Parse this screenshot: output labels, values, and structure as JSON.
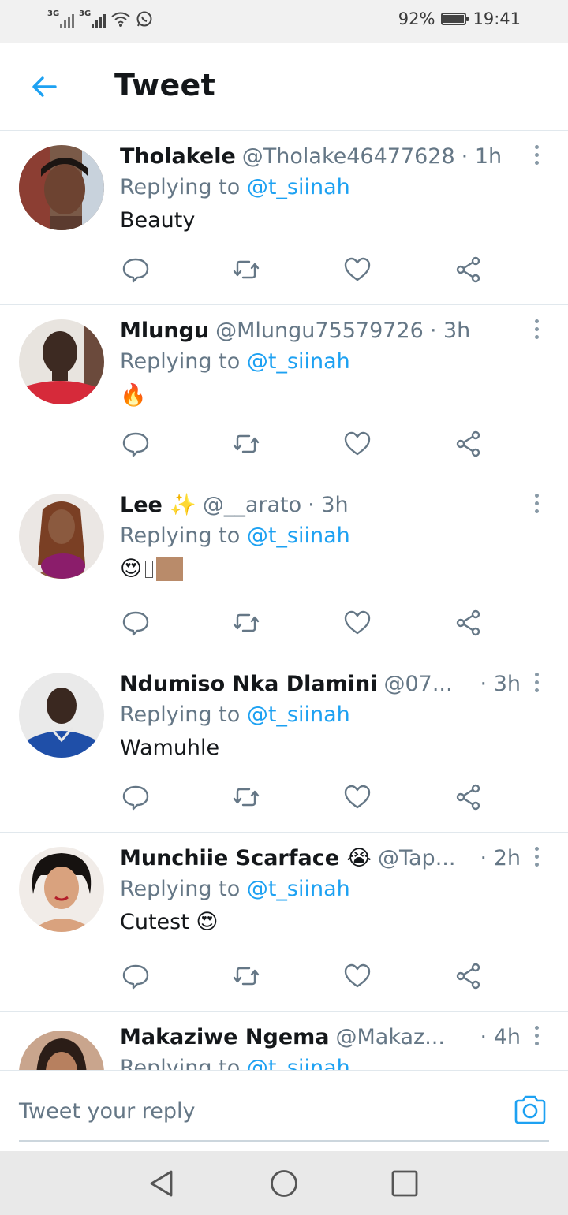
{
  "status_bar": {
    "network_1": "3G",
    "network_2": "3G",
    "battery": "92%",
    "time": "19:41"
  },
  "header": {
    "title": "Tweet"
  },
  "reply_prefix": "Replying to",
  "replying_to": "@t_siinah",
  "tweets": [
    {
      "name": "Tholakele",
      "handle": "@Tholake46477628",
      "time": "· 1h",
      "text": "Beauty"
    },
    {
      "name": "Mlungu",
      "handle": "@Mlungu75579726",
      "time": "· 3h",
      "text": "🔥"
    },
    {
      "name": "Lee ✨",
      "handle": "@__arato",
      "time": "· 3h",
      "text": "😍"
    },
    {
      "name": "Ndumiso Nka Dlamini",
      "handle": "@07...",
      "time": "· 3h",
      "text": "Wamuhle"
    },
    {
      "name": "Munchiie Scarface 😭",
      "handle": "@Tap...",
      "time": "· 2h",
      "text": "Cutest 😍"
    },
    {
      "name": "Makaziwe Ngema",
      "handle": "@Makaz...",
      "time": "· 4h",
      "text": ""
    }
  ],
  "composer": {
    "placeholder": "Tweet your reply"
  },
  "colors": {
    "accent": "#1da1f2",
    "secondary_text": "#657786",
    "divider": "#e1e8ed"
  }
}
